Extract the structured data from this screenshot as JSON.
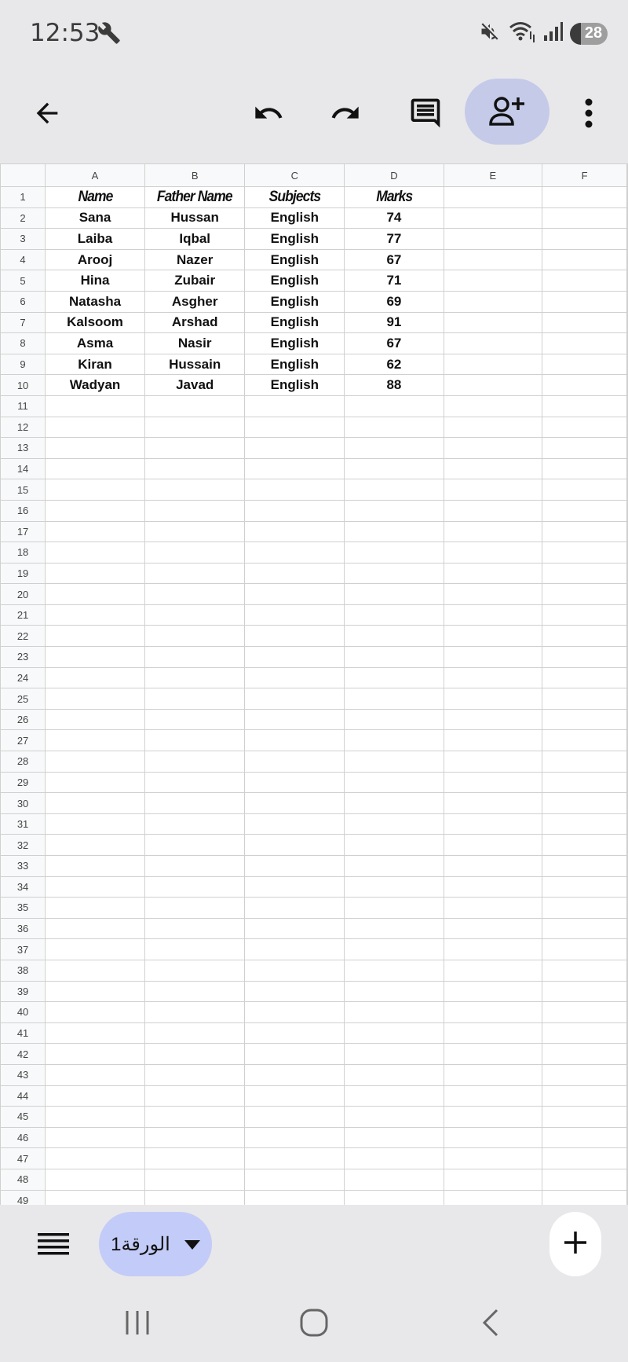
{
  "status_bar": {
    "time": "12:53",
    "battery": "28",
    "icons": [
      "wrench-icon",
      "mute-icon",
      "wifi-icon",
      "signal-icon",
      "battery-icon"
    ]
  },
  "toolbar": {
    "icons": [
      "back-arrow-icon",
      "undo-icon",
      "redo-icon",
      "comment-icon",
      "add-person-icon",
      "more-vert-icon"
    ],
    "accent_color": "#c5cae9"
  },
  "spreadsheet": {
    "columns": [
      "A",
      "B",
      "C",
      "D",
      "E",
      "F"
    ],
    "header_row": [
      "Name",
      "Father Name",
      "Subjects",
      "Marks",
      "",
      ""
    ],
    "rows": [
      [
        "Sana",
        "Hussan",
        "English",
        "74",
        "",
        ""
      ],
      [
        "Laiba",
        "Iqbal",
        "English",
        "77",
        "",
        ""
      ],
      [
        "Arooj",
        "Nazer",
        "English",
        "67",
        "",
        ""
      ],
      [
        "Hina",
        "Zubair",
        "English",
        "71",
        "",
        ""
      ],
      [
        "Natasha",
        "Asgher",
        "English",
        "69",
        "",
        ""
      ],
      [
        "Kalsoom",
        "Arshad",
        "English",
        "91",
        "",
        ""
      ],
      [
        "Asma",
        "Nasir",
        "English",
        "67",
        "",
        ""
      ],
      [
        "Kiran",
        "Hussain",
        "English",
        "62",
        "",
        ""
      ],
      [
        "Wadyan",
        "Javad",
        "English",
        "88",
        "",
        ""
      ]
    ],
    "row_numbers": [
      "1",
      "2",
      "3",
      "4",
      "5",
      "6",
      "7",
      "8",
      "9",
      "10",
      "11",
      "12",
      "13",
      "14",
      "15",
      "16",
      "17",
      "18",
      "19",
      "20",
      "21",
      "22",
      "23",
      "24",
      "25",
      "26",
      "27",
      "28",
      "29",
      "30",
      "31",
      "32",
      "33",
      "34",
      "35",
      "36",
      "37",
      "38",
      "39",
      "40",
      "41",
      "42",
      "43",
      "44",
      "45",
      "46",
      "47",
      "48",
      "49"
    ]
  },
  "bottom_bar": {
    "sheet_tab_label": "الورقة1",
    "sheet_tab_color": "#c3cbf8"
  }
}
